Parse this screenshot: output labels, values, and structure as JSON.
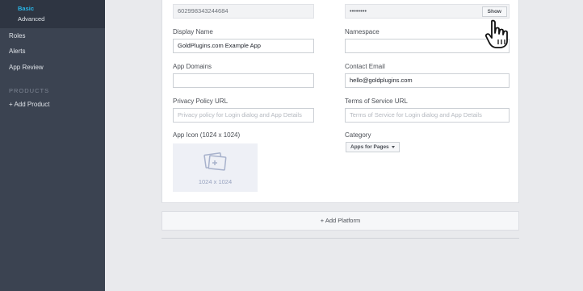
{
  "sidebar": {
    "basic": "Basic",
    "advanced": "Advanced",
    "roles": "Roles",
    "alerts": "Alerts",
    "app_review": "App Review",
    "products_header": "PRODUCTS",
    "add_product": "+ Add Product"
  },
  "form": {
    "app_id_value": "602998343244684",
    "app_secret_value": "••••••••",
    "show_label": "Show",
    "display_name_label": "Display Name",
    "display_name_value": "GoldPlugins.com Example App",
    "namespace_label": "Namespace",
    "namespace_value": "",
    "app_domains_label": "App Domains",
    "app_domains_value": "",
    "contact_email_label": "Contact Email",
    "contact_email_value": "hello@goldplugins.com",
    "privacy_label": "Privacy Policy URL",
    "privacy_placeholder": "Privacy policy for Login dialog and App Details",
    "tos_label": "Terms of Service URL",
    "tos_placeholder": "Terms of Service for Login dialog and App Details",
    "app_icon_label": "App Icon (1024 x 1024)",
    "app_icon_dims": "1024 x 1024",
    "category_label": "Category",
    "category_value": "Apps for Pages"
  },
  "add_platform_label": "+ Add Platform",
  "colors": {
    "sidebar_bg": "#3b4351",
    "active_link": "#29b6e8",
    "page_bg": "#e9eaed"
  }
}
